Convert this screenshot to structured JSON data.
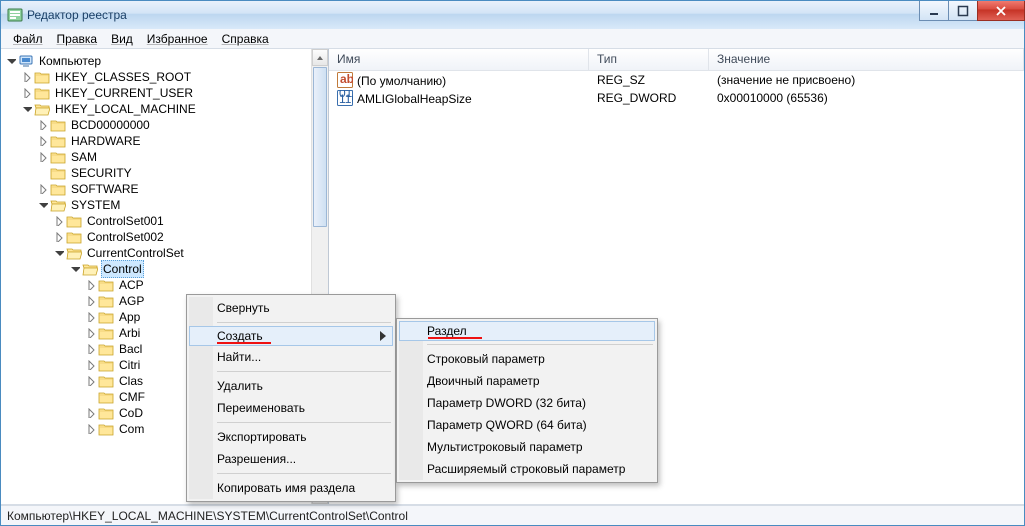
{
  "window": {
    "title": "Редактор реестра"
  },
  "menu": {
    "file": "Файл",
    "edit": "Правка",
    "view": "Вид",
    "fav": "Избранное",
    "help": "Справка"
  },
  "tree": {
    "root": "Компьютер",
    "hcr": "HKEY_CLASSES_ROOT",
    "hcu": "HKEY_CURRENT_USER",
    "hlm": "HKEY_LOCAL_MACHINE",
    "hlm_children": {
      "bcd": "BCD00000000",
      "hardware": "HARDWARE",
      "sam": "SAM",
      "security": "SECURITY",
      "software": "SOFTWARE",
      "system": "SYSTEM"
    },
    "system_children": {
      "cs1": "ControlSet001",
      "cs2": "ControlSet002",
      "ccs": "CurrentControlSet"
    },
    "ccs_children": {
      "control": "Control"
    },
    "control_children": {
      "acp": "ACP",
      "agp": "AGP",
      "app": "App",
      "arb": "Arbi",
      "bac": "Bacl",
      "cit": "Citri",
      "cla": "Clas",
      "cmf": "CMF",
      "cod": "CoD",
      "com": "Com"
    }
  },
  "columns": {
    "name": "Имя",
    "type": "Тип",
    "value": "Значение"
  },
  "rows": [
    {
      "name": "(По умолчанию)",
      "type": "REG_SZ",
      "value": "(значение не присвоено)",
      "icon": "sz"
    },
    {
      "name": "AMLIGlobalHeapSize",
      "type": "REG_DWORD",
      "value": "0x00010000 (65536)",
      "icon": "bin"
    }
  ],
  "ctx": {
    "collapse": "Свернуть",
    "new": "Создать",
    "find": "Найти...",
    "delete": "Удалить",
    "rename": "Переименовать",
    "export": "Экспортировать",
    "perm": "Разрешения...",
    "copykey": "Копировать имя раздела"
  },
  "submenu": {
    "key": "Раздел",
    "string": "Строковый параметр",
    "binary": "Двоичный параметр",
    "dword": "Параметр DWORD (32 бита)",
    "qword": "Параметр QWORD (64 бита)",
    "multi": "Мультистроковый параметр",
    "expand": "Расширяемый строковый параметр"
  },
  "status": "Компьютер\\HKEY_LOCAL_MACHINE\\SYSTEM\\CurrentControlSet\\Control"
}
